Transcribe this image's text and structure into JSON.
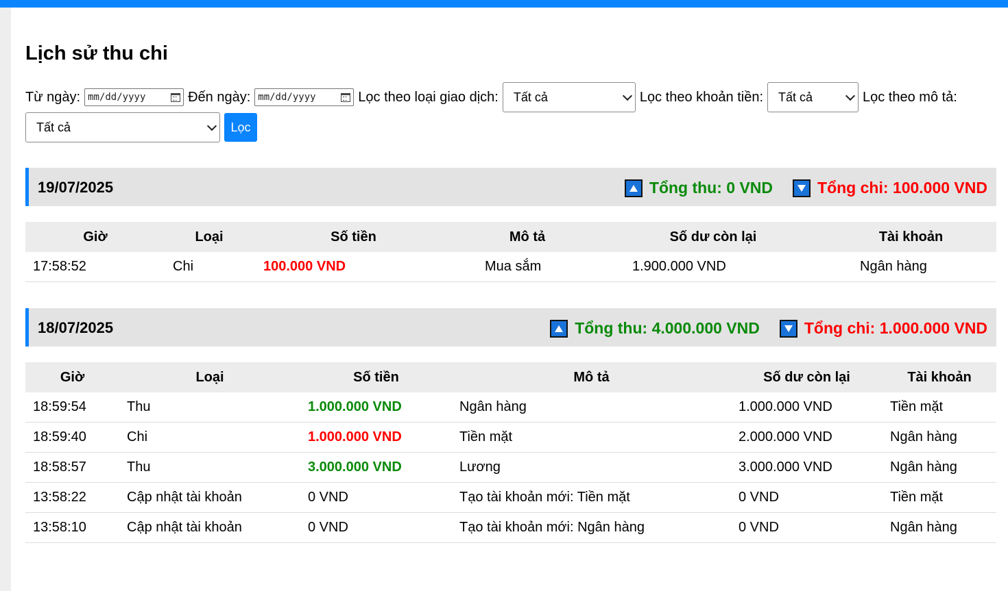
{
  "page_title": "Lịch sử thu chi",
  "filters": {
    "from_label": "Từ ngày:",
    "from_placeholder": "mm/dd/yyyy",
    "to_label": "Đến ngày:",
    "to_placeholder": "mm/dd/yyyy",
    "type_label": "Lọc theo loại giao dịch:",
    "type_value": "Tất cả",
    "account_label": "Lọc theo khoản tiền:",
    "account_value": "Tất cả",
    "desc_label": "Lọc theo mô tả:",
    "desc_value": "Tất cả",
    "filter_button": "Lọc"
  },
  "columns": {
    "time": "Giờ",
    "type": "Loại",
    "amount": "Số tiền",
    "desc": "Mô tả",
    "balance": "Số dư còn lại",
    "account": "Tài khoản"
  },
  "days": [
    {
      "date": "19/07/2025",
      "total_in": "Tổng thu: 0 VND",
      "total_out": "Tổng chi: 100.000 VND",
      "rows": [
        {
          "time": "17:58:52",
          "type": "Chi",
          "amount": "100.000 VND",
          "desc": "Mua sắm",
          "balance": "1.900.000 VND",
          "account": "Ngân hàng"
        }
      ]
    },
    {
      "date": "18/07/2025",
      "total_in": "Tổng thu: 4.000.000 VND",
      "total_out": "Tổng chi: 1.000.000 VND",
      "rows": [
        {
          "time": "18:59:54",
          "type": "Thu",
          "amount": "1.000.000 VND",
          "desc": "Ngân hàng",
          "balance": "1.000.000 VND",
          "account": "Tiền mặt"
        },
        {
          "time": "18:59:40",
          "type": "Chi",
          "amount": "1.000.000 VND",
          "desc": "Tiền mặt",
          "balance": "2.000.000 VND",
          "account": "Ngân hàng"
        },
        {
          "time": "18:58:57",
          "type": "Thu",
          "amount": "3.000.000 VND",
          "desc": "Lương",
          "balance": "3.000.000 VND",
          "account": "Ngân hàng"
        },
        {
          "time": "13:58:22",
          "type": "Cập nhật tài khoản",
          "amount": "0 VND",
          "desc": "Tạo tài khoản mới: Tiền mặt",
          "balance": "0 VND",
          "account": "Tiền mặt"
        },
        {
          "time": "13:58:10",
          "type": "Cập nhật tài khoản",
          "amount": "0 VND",
          "desc": "Tạo tài khoản mới: Ngân hàng",
          "balance": "0 VND",
          "account": "Ngân hàng"
        }
      ]
    }
  ],
  "colors": {
    "accent": "#0a84ff",
    "income": "#0a8a0a",
    "expense": "#ff0000"
  }
}
